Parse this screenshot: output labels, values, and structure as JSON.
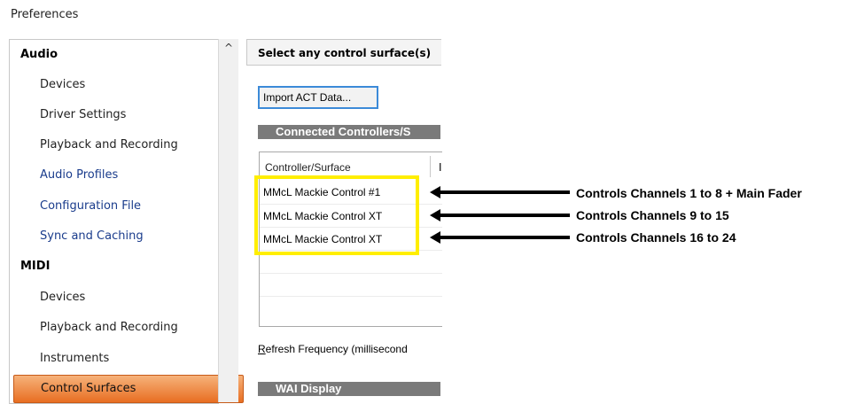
{
  "window": {
    "title": "Preferences"
  },
  "sidebar": {
    "items": [
      {
        "label": "Audio",
        "kind": "header"
      },
      {
        "label": "Devices",
        "kind": "child"
      },
      {
        "label": "Driver Settings",
        "kind": "child"
      },
      {
        "label": "Playback and Recording",
        "kind": "child"
      },
      {
        "label": "Audio Profiles",
        "kind": "link"
      },
      {
        "label": "Configuration File",
        "kind": "link"
      },
      {
        "label": "Sync and Caching",
        "kind": "link"
      },
      {
        "label": "MIDI",
        "kind": "header"
      },
      {
        "label": "Devices",
        "kind": "child"
      },
      {
        "label": "Playback and Recording",
        "kind": "child"
      },
      {
        "label": "Instruments",
        "kind": "child"
      },
      {
        "label": "Control Surfaces",
        "kind": "selected"
      }
    ],
    "scroll_up_glyph": "^",
    "selected_color": "#e86e22"
  },
  "panel": {
    "header": "Select any control surface(s)",
    "import_button": "Import ACT Data...",
    "connected_section": "Connected Controllers/S",
    "table": {
      "col1": "Controller/Surface",
      "col2": "I",
      "rows": [
        "MMcL Mackie Control #1",
        "MMcL Mackie Control XT",
        "MMcL Mackie Control XT"
      ]
    },
    "refresh_prefix": "R",
    "refresh_rest": "efresh Frequency (millisecond",
    "wai_section": "WAI Display"
  },
  "annotations": [
    "Controls Channels 1 to 8 + Main Fader",
    "Controls Channels 9 to 15",
    "Controls Channels 16 to 24"
  ],
  "colors": {
    "highlight": "#ffee00",
    "button_border": "#3c8ad8",
    "section_bar": "#7a7a7a"
  }
}
